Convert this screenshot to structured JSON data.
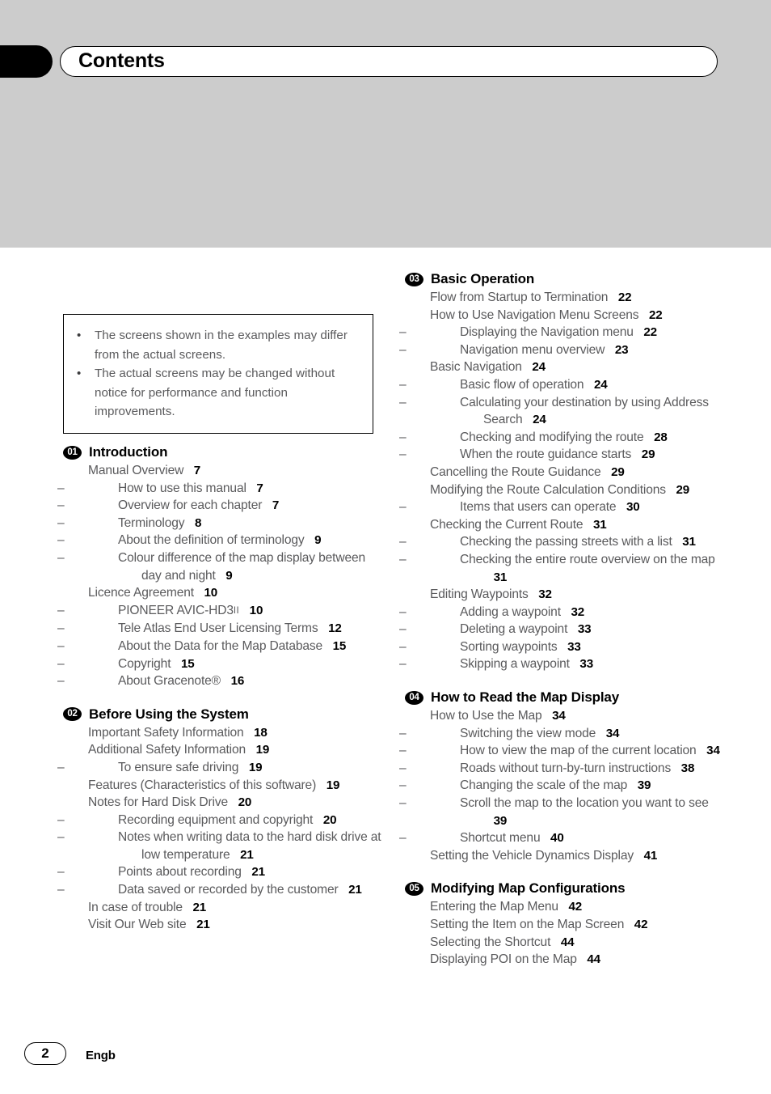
{
  "header": {
    "title": "Contents"
  },
  "note_box": {
    "bullet_glyph": "•",
    "items": [
      "The screens shown in the examples may differ from the actual screens.",
      "The actual screens may be changed without notice for performance and function improvements."
    ]
  },
  "columns": {
    "left": [
      {
        "number": "01",
        "title": "Introduction",
        "entries": [
          {
            "level": 1,
            "text": "Manual Overview",
            "page": "7"
          },
          {
            "level": 2,
            "text": "How to use this manual",
            "page": "7"
          },
          {
            "level": 2,
            "text": "Overview for each chapter",
            "page": "7"
          },
          {
            "level": 2,
            "text": "Terminology",
            "page": "8"
          },
          {
            "level": 2,
            "text": "About the definition of terminology",
            "page": "9"
          },
          {
            "level": 2,
            "text": "Colour difference of the map display between day and night",
            "page": "9"
          },
          {
            "level": 1,
            "text": "Licence Agreement",
            "page": "10"
          },
          {
            "level": 2,
            "text": "PIONEER AVIC-HD3",
            "suffix_roman": "II",
            "page": "10"
          },
          {
            "level": 2,
            "text": "Tele Atlas End User Licensing Terms",
            "page": "12"
          },
          {
            "level": 2,
            "text": "About the Data for the Map Database",
            "page": "15"
          },
          {
            "level": 2,
            "text": "Copyright",
            "page": "15"
          },
          {
            "level": 2,
            "text": "About Gracenote®",
            "page": "16"
          }
        ]
      },
      {
        "number": "02",
        "title": "Before Using the System",
        "entries": [
          {
            "level": 1,
            "text": "Important Safety Information",
            "page": "18"
          },
          {
            "level": 1,
            "text": "Additional Safety Information",
            "page": "19"
          },
          {
            "level": 2,
            "text": "To ensure safe driving",
            "page": "19"
          },
          {
            "level": 1,
            "text": "Features (Characteristics of this software)",
            "page": "19"
          },
          {
            "level": 1,
            "text": "Notes for Hard Disk Drive",
            "page": "20"
          },
          {
            "level": 2,
            "text": "Recording equipment and copyright",
            "page": "20"
          },
          {
            "level": 2,
            "text": "Notes when writing data to the hard disk drive at low temperature",
            "page": "21"
          },
          {
            "level": 2,
            "text": "Points about recording",
            "page": "21"
          },
          {
            "level": 2,
            "text": "Data saved or recorded by the customer",
            "page": "21"
          },
          {
            "level": 1,
            "text": "In case of trouble",
            "page": "21"
          },
          {
            "level": 1,
            "text": "Visit Our Web site",
            "page": "21"
          }
        ]
      }
    ],
    "right": [
      {
        "number": "03",
        "title": "Basic Operation",
        "entries": [
          {
            "level": 1,
            "text": "Flow from Startup to Termination",
            "page": "22"
          },
          {
            "level": 1,
            "text": "How to Use Navigation Menu Screens",
            "page": "22"
          },
          {
            "level": 2,
            "text": "Displaying the Navigation menu",
            "page": "22"
          },
          {
            "level": 2,
            "text": "Navigation menu overview",
            "page": "23"
          },
          {
            "level": 1,
            "text": "Basic Navigation",
            "page": "24"
          },
          {
            "level": 2,
            "text": "Basic flow of operation",
            "page": "24"
          },
          {
            "level": 2,
            "text": "Calculating your destination by using Address Search",
            "page": "24"
          },
          {
            "level": 2,
            "text": "Checking and modifying the route",
            "page": "28"
          },
          {
            "level": 2,
            "text": "When the route guidance starts",
            "page": "29"
          },
          {
            "level": 1,
            "text": "Cancelling the Route Guidance",
            "page": "29"
          },
          {
            "level": 1,
            "text": "Modifying the Route Calculation Conditions",
            "page": "29"
          },
          {
            "level": 2,
            "text": "Items that users can operate",
            "page": "30"
          },
          {
            "level": 1,
            "text": "Checking the Current Route",
            "page": "31"
          },
          {
            "level": 2,
            "text": "Checking the passing streets with a list",
            "page": "31"
          },
          {
            "level": 2,
            "text": "Checking the entire route overview on the map",
            "page": "31"
          },
          {
            "level": 1,
            "text": "Editing Waypoints",
            "page": "32"
          },
          {
            "level": 2,
            "text": "Adding a waypoint",
            "page": "32"
          },
          {
            "level": 2,
            "text": "Deleting a waypoint",
            "page": "33"
          },
          {
            "level": 2,
            "text": "Sorting waypoints",
            "page": "33"
          },
          {
            "level": 2,
            "text": "Skipping a waypoint",
            "page": "33"
          }
        ]
      },
      {
        "number": "04",
        "title": "How to Read the Map Display",
        "entries": [
          {
            "level": 1,
            "text": "How to Use the Map",
            "page": "34"
          },
          {
            "level": 2,
            "text": "Switching the view mode",
            "page": "34"
          },
          {
            "level": 2,
            "text": "How to view the map of the current location",
            "page": "34"
          },
          {
            "level": 2,
            "text": "Roads without turn-by-turn instructions",
            "page": "38"
          },
          {
            "level": 2,
            "text": "Changing the scale of the map",
            "page": "39"
          },
          {
            "level": 2,
            "text": "Scroll the map to the location you want to see",
            "page": "39"
          },
          {
            "level": 2,
            "text": "Shortcut menu",
            "page": "40"
          },
          {
            "level": 1,
            "text": "Setting the Vehicle Dynamics Display",
            "page": "41"
          }
        ]
      },
      {
        "number": "05",
        "title": "Modifying Map Configurations",
        "entries": [
          {
            "level": 1,
            "text": "Entering the Map Menu",
            "page": "42"
          },
          {
            "level": 1,
            "text": "Setting the Item on the Map Screen",
            "page": "42"
          },
          {
            "level": 1,
            "text": "Selecting the Shortcut",
            "page": "44"
          },
          {
            "level": 1,
            "text": "Displaying POI on the Map",
            "page": "44"
          }
        ]
      }
    ]
  },
  "footer": {
    "page_number": "2",
    "language": "Engb"
  },
  "colors": {
    "band": "#cccccc",
    "text": "#5a5a5c",
    "accent": "#000000"
  }
}
